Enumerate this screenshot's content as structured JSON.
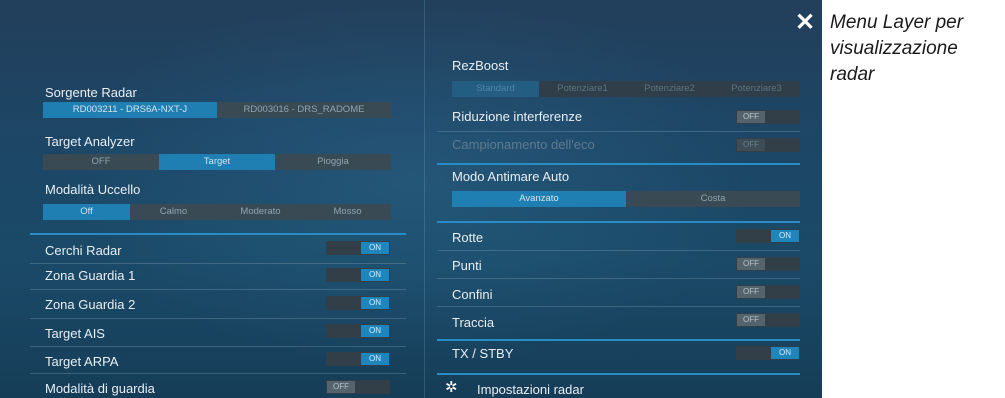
{
  "caption": {
    "line1": "Menu Layer per",
    "line2": "visualizzazione",
    "line3": "radar"
  },
  "close_icon": "close-icon",
  "left": {
    "sorgente_radar": {
      "label": "Sorgente Radar",
      "options": [
        "RD003211 - DRS6A-NXT-J",
        "RD003016 - DRS_RADOME"
      ],
      "selected": 0
    },
    "target_analyzer": {
      "label": "Target Analyzer",
      "options": [
        "OFF",
        "Target",
        "Pioggia"
      ],
      "selected": 1
    },
    "modalita_uccello": {
      "label": "Modalità Uccello",
      "options": [
        "Off",
        "Calmo",
        "Moderato",
        "Mosso"
      ],
      "selected": 0
    },
    "toggles": [
      {
        "label": "Cerchi Radar",
        "state": "ON"
      },
      {
        "label": "Zona Guardia 1",
        "state": "ON"
      },
      {
        "label": "Zona Guardia 2",
        "state": "ON"
      },
      {
        "label": "Target AIS",
        "state": "ON"
      },
      {
        "label": "Target ARPA",
        "state": "ON"
      },
      {
        "label": "Modalità di guardia",
        "state": "OFF"
      }
    ]
  },
  "right": {
    "rezboost": {
      "label": "RezBoost",
      "options": [
        "Standard",
        "Potenziare1",
        "Potenziare2",
        "Potenziare3"
      ],
      "selected": 0
    },
    "riduzione": {
      "label": "Riduzione interferenze",
      "state": "OFF"
    },
    "campionamento": {
      "label": "Campionamento dell'eco",
      "state": "OFF"
    },
    "antimare": {
      "label": "Modo Antimare Auto",
      "options": [
        "Avanzato",
        "Costa"
      ],
      "selected": 0
    },
    "toggles": [
      {
        "label": "Rotte",
        "state": "ON"
      },
      {
        "label": "Punti",
        "state": "OFF"
      },
      {
        "label": "Confini",
        "state": "OFF"
      },
      {
        "label": "Traccia",
        "state": "OFF"
      }
    ],
    "tx_stby": {
      "label": "TX / STBY",
      "state": "ON"
    },
    "settings": {
      "label": "Impostazioni radar",
      "icon": "gear-icon"
    }
  }
}
